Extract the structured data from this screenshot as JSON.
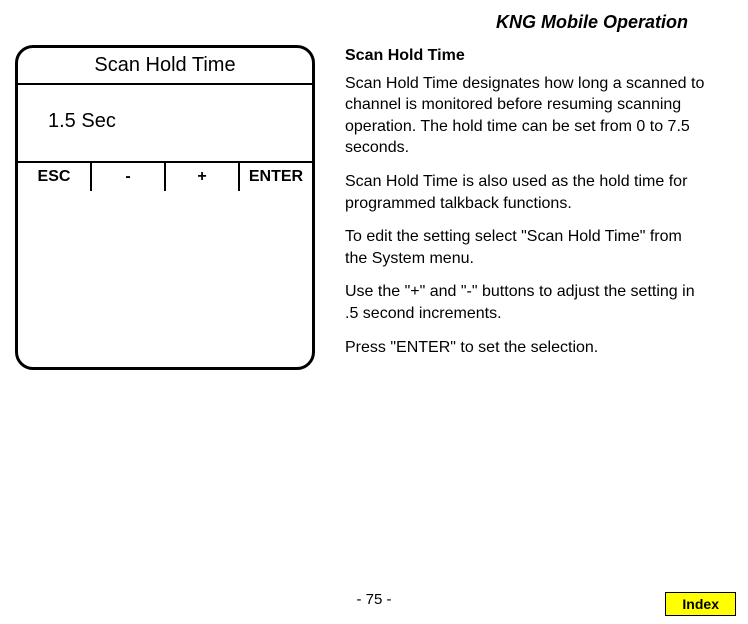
{
  "header": {
    "title": "KNG Mobile Operation"
  },
  "device": {
    "title": "Scan Hold Time",
    "value": "1.5 Sec",
    "buttons": {
      "esc": "ESC",
      "minus": "-",
      "plus": "+",
      "enter": "ENTER"
    }
  },
  "text": {
    "heading": "Scan Hold Time",
    "p1": "Scan Hold Time designates how long a scanned to channel is monitored before resuming scanning operation. The hold time can be set from 0 to 7.5 seconds.",
    "p2": "Scan Hold Time is also used as the hold time for programmed talkback functions.",
    "p3": "To edit the setting select \"Scan Hold Time\" from the System menu.",
    "p4": "Use the \"+\" and \"-\" buttons to adjust the setting in .5 second increments.",
    "p5": "Press \"ENTER\" to set the selection."
  },
  "footer": {
    "page": "- 75 -",
    "index": "Index"
  }
}
